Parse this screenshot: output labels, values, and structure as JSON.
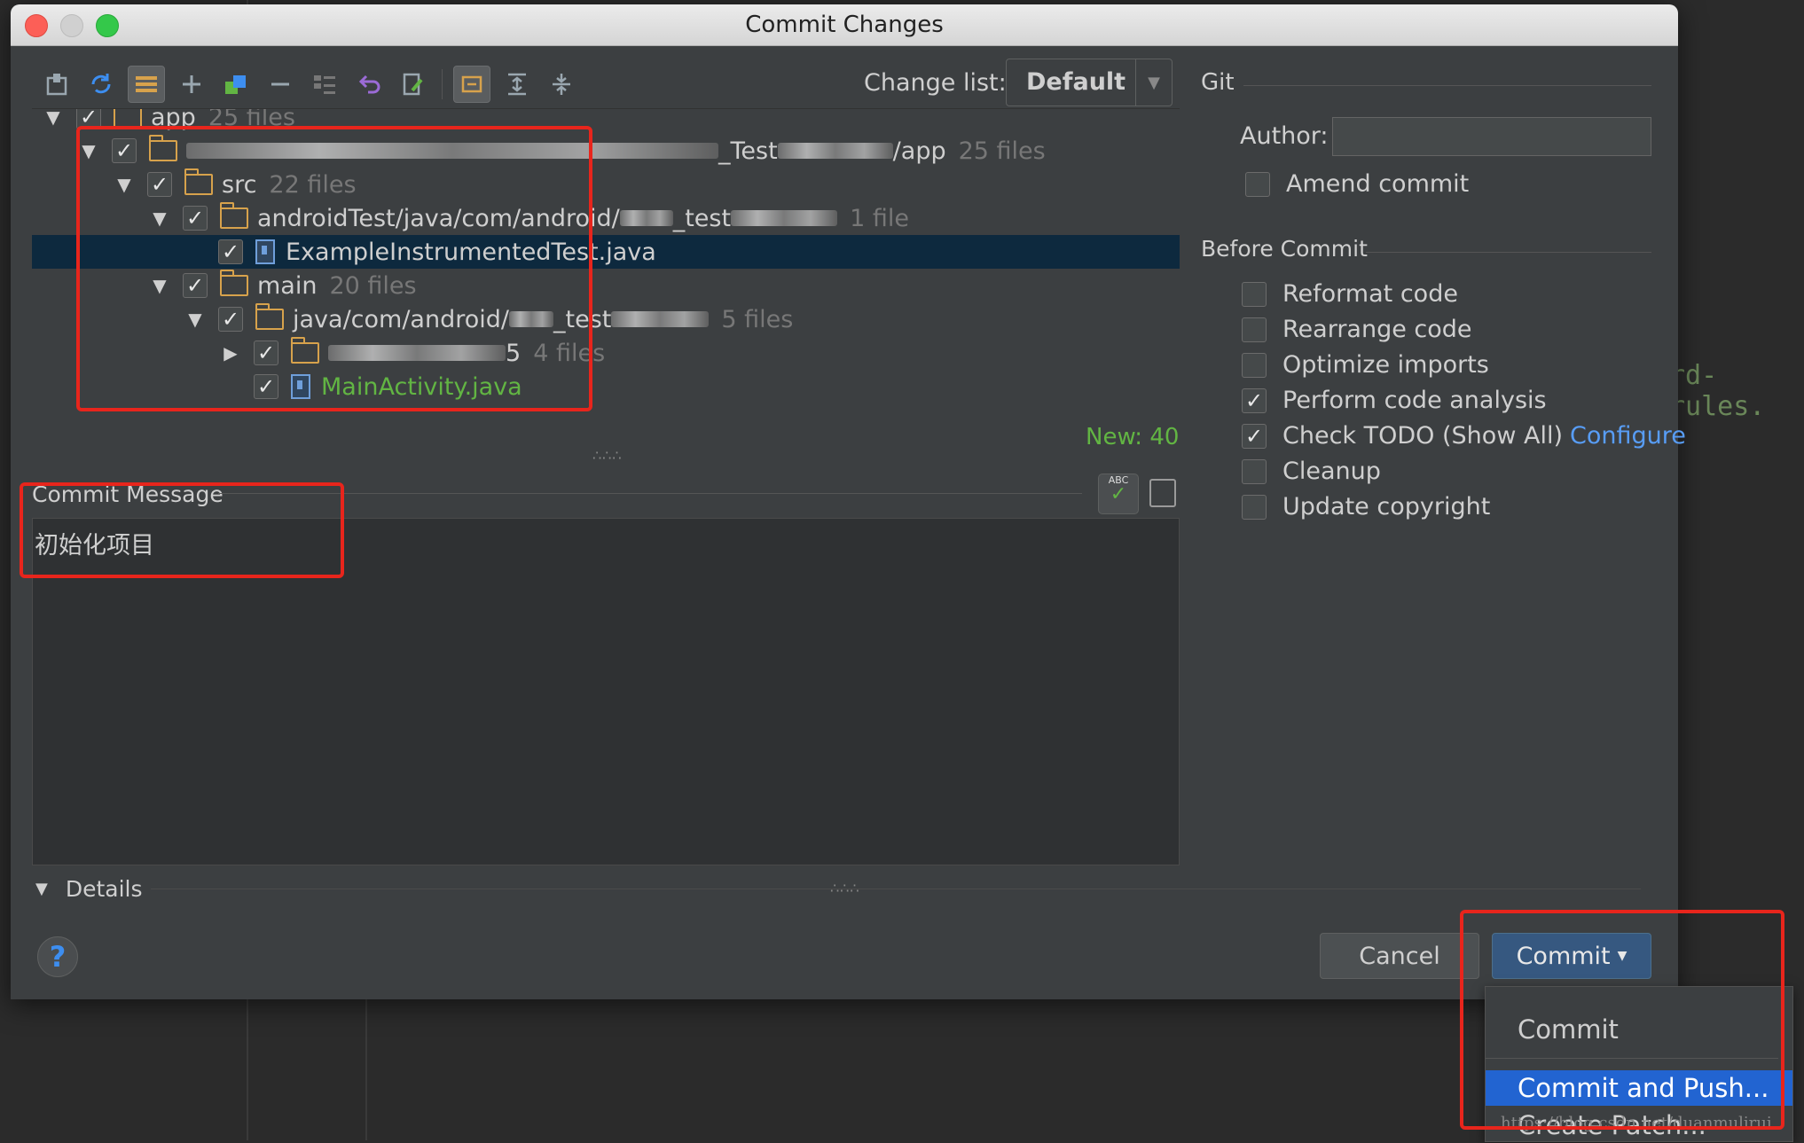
{
  "window": {
    "title": "Commit Changes"
  },
  "background": {
    "code_fragment": "rd-rules."
  },
  "toolbar": {
    "icons": [
      "vcs-diff-icon",
      "refresh-icon",
      "group-by-icon",
      "add-icon",
      "move-to-changelist-icon",
      "remove-icon",
      "expand-all-icon",
      "rollback-icon",
      "edit-source-icon",
      "show-diff-icon",
      "expand-icon",
      "collapse-icon"
    ]
  },
  "changelist": {
    "label": "Change list:",
    "value": "Default"
  },
  "tree": {
    "rows": [
      {
        "name": "app",
        "count": "25 files"
      },
      {
        "name_suffix": "_Test",
        "name_end": "/app",
        "count": "25 files"
      },
      {
        "name": "src",
        "count": "22 files"
      },
      {
        "name": "androidTest/java/com/android/",
        "name_suffix": "_test",
        "count": "1 file"
      },
      {
        "name": "ExampleInstrumentedTest.java"
      },
      {
        "name": "main",
        "count": "20 files"
      },
      {
        "name": "java/com/android/",
        "name_suffix": "_test",
        "count": "5 files"
      },
      {
        "name_suffix": "5",
        "count": "4 files"
      },
      {
        "name": "MainActivity.java"
      }
    ],
    "new_count": "New: 40"
  },
  "commit_message": {
    "label": "Commit Message",
    "text": "初始化项目",
    "spell_icon_text": "ABC"
  },
  "details": {
    "label": "Details"
  },
  "git": {
    "label": "Git",
    "author_label": "Author:",
    "author_value": "",
    "amend_label": "Amend commit"
  },
  "before_commit": {
    "label": "Before Commit",
    "options": [
      {
        "label": "Reformat code",
        "checked": false
      },
      {
        "label": "Rearrange code",
        "checked": false
      },
      {
        "label": "Optimize imports",
        "checked": false
      },
      {
        "label": "Perform code analysis",
        "checked": true
      },
      {
        "label": "Check TODO (Show All)",
        "checked": true,
        "link": "Configure"
      },
      {
        "label": "Cleanup",
        "checked": false
      },
      {
        "label": "Update copyright",
        "checked": false
      }
    ]
  },
  "buttons": {
    "help": "?",
    "cancel": "Cancel",
    "commit": "Commit"
  },
  "menu": {
    "items": [
      "Commit",
      "Commit and Push...",
      "Create Patch..."
    ]
  },
  "watermark": "https://blog.csdn.net/duanmulirui",
  "colors": {
    "accent": "#2264d1",
    "annotation": "#e8251c",
    "new_files": "#62b543",
    "link": "#589df6"
  }
}
